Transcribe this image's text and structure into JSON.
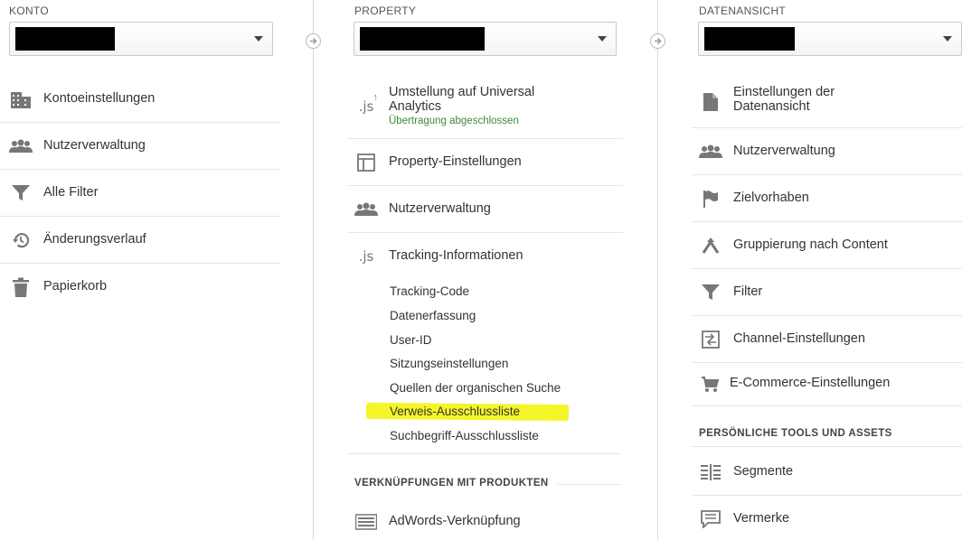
{
  "konto": {
    "header": "KONTO",
    "items": [
      {
        "label": "Kontoeinstellungen",
        "icon": "building-icon"
      },
      {
        "label": "Nutzerverwaltung",
        "icon": "users-icon"
      },
      {
        "label": "Alle Filter",
        "icon": "filter-icon"
      },
      {
        "label": "Änderungsverlauf",
        "icon": "history-icon"
      },
      {
        "label": "Papierkorb",
        "icon": "trash-icon"
      }
    ]
  },
  "property": {
    "header": "PROPERTY",
    "universal": {
      "label": "Umstellung auf Universal Analytics",
      "status": "Übertragung abgeschlossen",
      "icon": "js-upgrade-icon"
    },
    "items": [
      {
        "label": "Property-Einstellungen",
        "icon": "property-settings-icon"
      },
      {
        "label": "Nutzerverwaltung",
        "icon": "users-icon"
      },
      {
        "label": "Tracking-Informationen",
        "icon": "js-icon"
      }
    ],
    "tracking_subitems": [
      "Tracking-Code",
      "Datenerfassung",
      "User-ID",
      "Sitzungseinstellungen",
      "Quellen der organischen Suche",
      "Verweis-Ausschlussliste",
      "Suchbegriff-Ausschlussliste"
    ],
    "highlighted_subitem": "Verweis-Ausschlussliste",
    "section_products": "VERKNÜPFUNGEN MIT PRODUKTEN",
    "adwords": {
      "label": "AdWords-Verknüpfung",
      "icon": "adwords-link-icon"
    }
  },
  "view": {
    "header": "DATENANSICHT",
    "items": [
      {
        "label": "Einstellungen der Datenansicht",
        "icon": "document-icon"
      },
      {
        "label": "Nutzerverwaltung",
        "icon": "users-icon"
      },
      {
        "label": "Zielvorhaben",
        "icon": "flag-icon"
      },
      {
        "label": "Gruppierung nach Content",
        "icon": "content-grouping-icon"
      },
      {
        "label": "Filter",
        "icon": "filter-icon"
      },
      {
        "label": "Channel-Einstellungen",
        "icon": "channel-settings-icon"
      },
      {
        "label": "E-Commerce-Einstellungen",
        "icon": "cart-icon"
      }
    ],
    "section_tools": "PERSÖNLICHE TOOLS UND ASSETS",
    "tools": [
      {
        "label": "Segmente",
        "icon": "segments-icon"
      },
      {
        "label": "Vermerke",
        "icon": "annotation-icon"
      }
    ]
  },
  "colors": {
    "accent_green": "#3d8b37",
    "highlight": "#f5f52a",
    "icon_gray": "#777777"
  }
}
